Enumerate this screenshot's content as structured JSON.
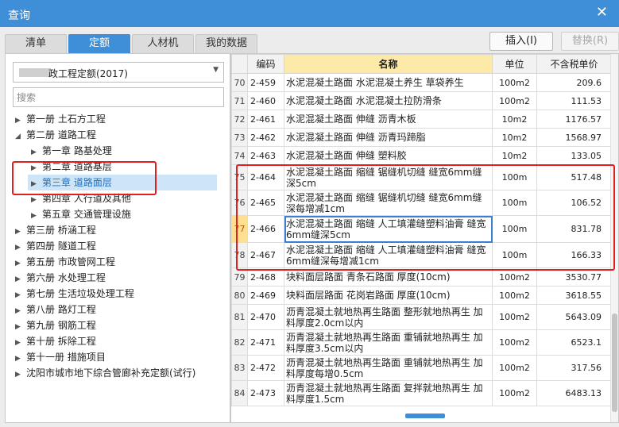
{
  "window": {
    "title": "查询",
    "close_icon": "close-icon"
  },
  "tabs": [
    {
      "label": "清单",
      "active": false
    },
    {
      "label": "定额",
      "active": true
    },
    {
      "label": "人材机",
      "active": false
    },
    {
      "label": "我的数据",
      "active": false
    }
  ],
  "toolbar": {
    "insert_label": "插入(I)",
    "replace_label": "替换(R)"
  },
  "left": {
    "quota_select": "政工程定额(2017)",
    "search_placeholder": "搜索",
    "tree": [
      {
        "label": "第一册 土石方工程",
        "level": 0,
        "arrow": "right"
      },
      {
        "label": "第二册 道路工程",
        "level": 0,
        "arrow": "down"
      },
      {
        "label": "第一章 路基处理",
        "level": 1,
        "arrow": "right"
      },
      {
        "label": "第二章 道路基层",
        "level": 1,
        "arrow": "right"
      },
      {
        "label": "第三章 道路面层",
        "level": 1,
        "arrow": "right",
        "selected": true
      },
      {
        "label": "第四章 人行道及其他",
        "level": 1,
        "arrow": "right"
      },
      {
        "label": "第五章 交通管理设施",
        "level": 1,
        "arrow": "right"
      },
      {
        "label": "第三册 桥涵工程",
        "level": 0,
        "arrow": "right"
      },
      {
        "label": "第四册 隧道工程",
        "level": 0,
        "arrow": "right"
      },
      {
        "label": "第五册 市政管网工程",
        "level": 0,
        "arrow": "right"
      },
      {
        "label": "第六册 水处理工程",
        "level": 0,
        "arrow": "right"
      },
      {
        "label": "第七册 生活垃圾处理工程",
        "level": 0,
        "arrow": "right"
      },
      {
        "label": "第八册 路灯工程",
        "level": 0,
        "arrow": "right"
      },
      {
        "label": "第九册 钢筋工程",
        "level": 0,
        "arrow": "right"
      },
      {
        "label": "第十册 拆除工程",
        "level": 0,
        "arrow": "right"
      },
      {
        "label": "第十一册 措施项目",
        "level": 0,
        "arrow": "right"
      },
      {
        "label": "沈阳市城市地下综合管廊补充定额(试行)",
        "level": 0,
        "arrow": "right"
      }
    ]
  },
  "grid": {
    "headers": {
      "code": "编码",
      "name": "名称",
      "unit": "单位",
      "price": "不含税单价"
    },
    "rows": [
      {
        "n": "70",
        "code": "2-459",
        "name": "水泥混凝土路面 水泥混凝土养生 草袋养生",
        "unit": "100m2",
        "price": "209.6"
      },
      {
        "n": "71",
        "code": "2-460",
        "name": "水泥混凝土路面 水泥混凝土拉防滑条",
        "unit": "100m2",
        "price": "111.53"
      },
      {
        "n": "72",
        "code": "2-461",
        "name": "水泥混凝土路面 伸缝 沥青木板",
        "unit": "10m2",
        "price": "1176.57"
      },
      {
        "n": "73",
        "code": "2-462",
        "name": "水泥混凝土路面 伸缝 沥青玛蹄脂",
        "unit": "10m2",
        "price": "1568.97"
      },
      {
        "n": "74",
        "code": "2-463",
        "name": "水泥混凝土路面 伸缝 塑料胶",
        "unit": "10m2",
        "price": "133.05"
      },
      {
        "n": "75",
        "code": "2-464",
        "name": "水泥混凝土路面 缩缝 锯缝机切缝 缝宽6mm缝深5cm",
        "unit": "100m",
        "price": "517.48"
      },
      {
        "n": "76",
        "code": "2-465",
        "name": "水泥混凝土路面 缩缝 锯缝机切缝 缝宽6mm缝深每增减1cm",
        "unit": "100m",
        "price": "106.52"
      },
      {
        "n": "77",
        "code": "2-466",
        "name": "水泥混凝土路面 缩缝 人工填灌缝塑料油膏 缝宽6mm缝深5cm",
        "unit": "100m",
        "price": "831.78",
        "current": true
      },
      {
        "n": "78",
        "code": "2-467",
        "name": "水泥混凝土路面 缩缝 人工填灌缝塑料油膏 缝宽6mm缝深每增减1cm",
        "unit": "100m",
        "price": "166.33"
      },
      {
        "n": "79",
        "code": "2-468",
        "name": "块料面层路面 青条石路面 厚度(10cm)",
        "unit": "100m2",
        "price": "3530.77"
      },
      {
        "n": "80",
        "code": "2-469",
        "name": "块料面层路面 花岗岩路面 厚度(10cm)",
        "unit": "100m2",
        "price": "3618.55"
      },
      {
        "n": "81",
        "code": "2-470",
        "name": "沥青混凝土就地热再生路面 整形就地热再生 加料厚度2.0cm以内",
        "unit": "100m2",
        "price": "5643.09"
      },
      {
        "n": "82",
        "code": "2-471",
        "name": "沥青混凝土就地热再生路面 重铺就地热再生 加料厚度3.5cm以内",
        "unit": "100m2",
        "price": "6523.1"
      },
      {
        "n": "83",
        "code": "2-472",
        "name": "沥青混凝土就地热再生路面 重铺就地热再生 加料厚度每增0.5cm",
        "unit": "100m2",
        "price": "317.56"
      },
      {
        "n": "84",
        "code": "2-473",
        "name": "沥青混凝土就地热再生路面 复拌就地热再生 加料厚度1.5cm",
        "unit": "100m2",
        "price": "6483.13"
      }
    ]
  }
}
